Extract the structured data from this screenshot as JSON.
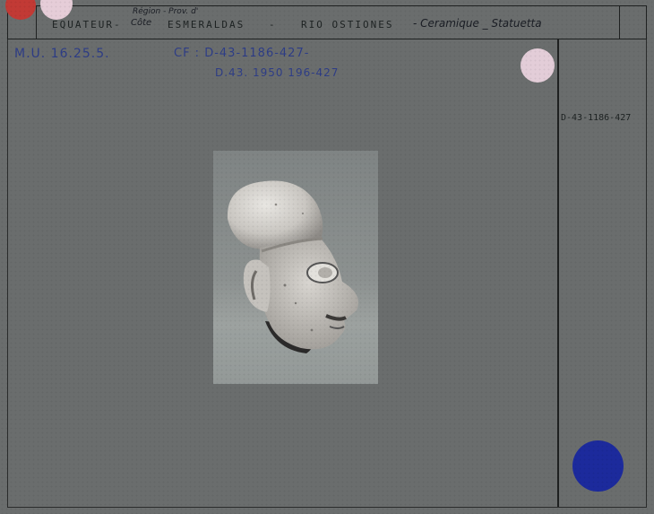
{
  "header": {
    "region_note": "Région - Prov. d'",
    "region_note_2": "Côte",
    "country": "EQUATEUR-",
    "province": "ESMERALDAS",
    "separator": "-",
    "site": "RIO OSTIONES",
    "separator_2": "- Ceramique _ Statuetta"
  },
  "left_ref": "M.U. 16.25.5.",
  "cf_line": "CF : D-43-1186-427-",
  "cf_line_2": "D.43. 1950 196-427",
  "right_ref": "D-43-1186-427",
  "colors": {
    "red_dot": "#c23a35",
    "pink_dot": "#e6cdd8",
    "blue_dot": "#1c2a9c"
  },
  "photo": {
    "icon": "ceramic-head-figurine"
  }
}
